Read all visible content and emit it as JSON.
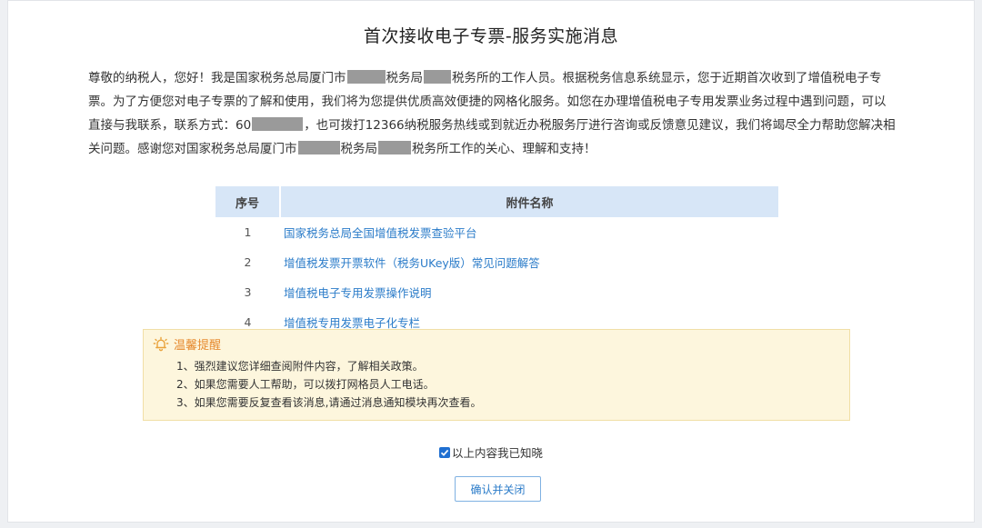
{
  "dialog": {
    "title": "首次接收电子专票-服务实施消息",
    "notice": {
      "p1": "尊敬的纳税人，您好！我是国家税务总局厦门市",
      "p2": "税务局",
      "p3": "税务所的工作人员。根据税务信息系统显示，您于近期首次收到了增值税电子专票。为了方便您对电子专票的了解和使用，我们将为您提供优质高效便捷的网格化服务。如您在办理增值税电子专用发票业务过程中遇到问题，可以直接与我联系，联系方式：60",
      "p4": "，也可拨打12366纳税服务热线或到就近办税服务厅进行咨询或反馈意见建议，我们将竭尽全力帮助您解决相关问题。感谢您对国家税务总局厦门市",
      "p5": "税务局",
      "p6": "税务所工作的关心、理解和支持！"
    },
    "attachments": {
      "headers": {
        "index": "序号",
        "name": "附件名称"
      },
      "rows": [
        {
          "index": "1",
          "name": "国家税务总局全国增值税发票查验平台"
        },
        {
          "index": "2",
          "name": "增值税发票开票软件（税务UKey版）常见问题解答"
        },
        {
          "index": "3",
          "name": "增值税电子专用发票操作说明"
        },
        {
          "index": "4",
          "name": "增值税专用发票电子化专栏"
        }
      ]
    },
    "tips": {
      "title": "温馨提醒",
      "icon": "bell-icon",
      "items": [
        "1、强烈建议您详细查阅附件内容，了解相关政策。",
        "2、如果您需要人工帮助，可以拨打网格员人工电话。",
        "3、如果您需要反复查看该消息,请通过消息通知模块再次查看。"
      ]
    },
    "acknowledge": {
      "label": "以上内容我已知晓",
      "checked": true
    },
    "confirm_button": "确认并关闭"
  },
  "colors": {
    "link": "#2b7cc9",
    "table_header_bg": "#d7e6f7",
    "tip_bg": "#fdf6dd",
    "tip_title": "#e68a2e",
    "checkbox": "#1f6fd1"
  }
}
